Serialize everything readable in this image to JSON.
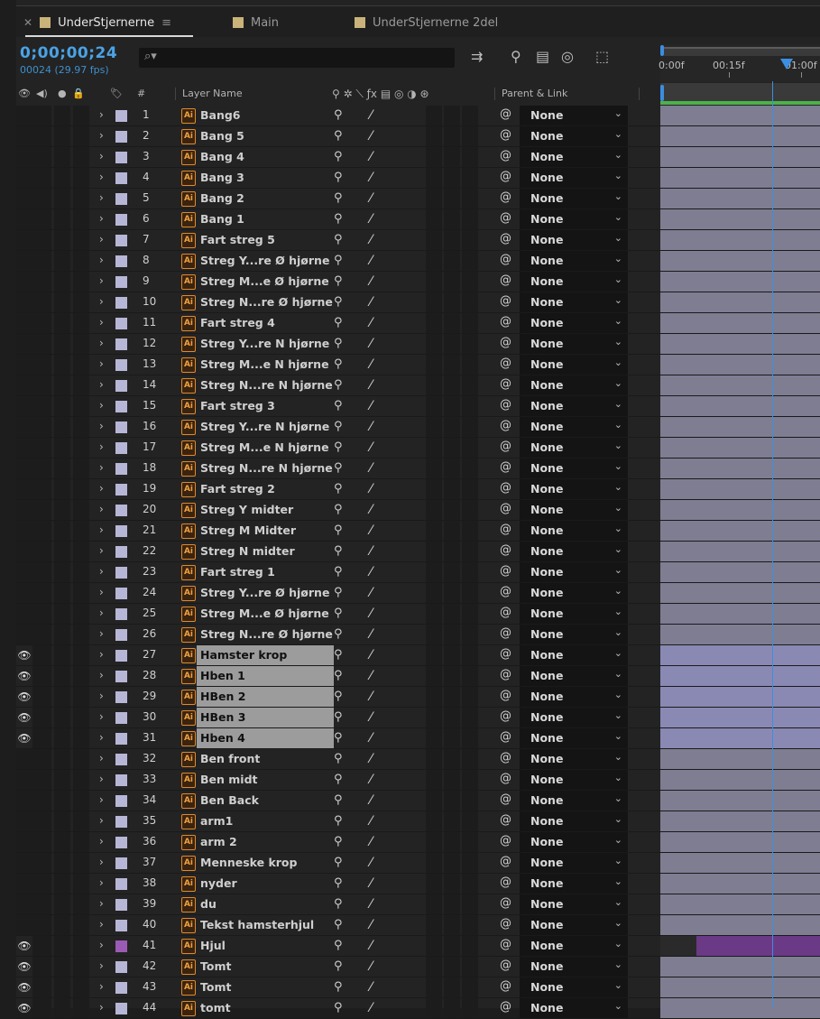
{
  "tabs": [
    {
      "label": "UnderStjernerne",
      "active": true
    },
    {
      "label": "Main",
      "active": false
    },
    {
      "label": "UnderStjernerne 2del",
      "active": false
    }
  ],
  "header": {
    "timecode": "0;00;00;24",
    "fps": "00024 (29.97 fps)",
    "search_placeholder": ""
  },
  "ruler": {
    "labels": [
      "0:00f",
      "00:15f",
      "01:00f"
    ]
  },
  "columns": {
    "num": "#",
    "layer_name": "Layer Name",
    "parent_link": "Parent & Link"
  },
  "parent_default": "None",
  "layers": [
    {
      "num": "1",
      "name": "Bang6",
      "visible": false,
      "selected": false
    },
    {
      "num": "2",
      "name": "Bang 5",
      "visible": false,
      "selected": false
    },
    {
      "num": "3",
      "name": "Bang 4",
      "visible": false,
      "selected": false
    },
    {
      "num": "4",
      "name": "Bang 3",
      "visible": false,
      "selected": false
    },
    {
      "num": "5",
      "name": "Bang 2",
      "visible": false,
      "selected": false
    },
    {
      "num": "6",
      "name": "Bang 1",
      "visible": false,
      "selected": false
    },
    {
      "num": "7",
      "name": "Fart streg 5",
      "visible": false,
      "selected": false
    },
    {
      "num": "8",
      "name": "Streg Y...re Ø hjørne",
      "visible": false,
      "selected": false
    },
    {
      "num": "9",
      "name": "Streg M...e Ø hjørne",
      "visible": false,
      "selected": false
    },
    {
      "num": "10",
      "name": "Streg N...re Ø hjørne",
      "visible": false,
      "selected": false
    },
    {
      "num": "11",
      "name": "Fart streg 4",
      "visible": false,
      "selected": false
    },
    {
      "num": "12",
      "name": "Streg Y...re N hjørne",
      "visible": false,
      "selected": false
    },
    {
      "num": "13",
      "name": "Streg M...e N hjørne",
      "visible": false,
      "selected": false
    },
    {
      "num": "14",
      "name": "Streg N...re N hjørne",
      "visible": false,
      "selected": false
    },
    {
      "num": "15",
      "name": "Fart streg 3",
      "visible": false,
      "selected": false
    },
    {
      "num": "16",
      "name": "Streg Y...re N hjørne",
      "visible": false,
      "selected": false
    },
    {
      "num": "17",
      "name": "Streg M...e N hjørne",
      "visible": false,
      "selected": false
    },
    {
      "num": "18",
      "name": "Streg N...re N hjørne",
      "visible": false,
      "selected": false
    },
    {
      "num": "19",
      "name": "Fart streg 2",
      "visible": false,
      "selected": false
    },
    {
      "num": "20",
      "name": "Streg Y midter",
      "visible": false,
      "selected": false
    },
    {
      "num": "21",
      "name": "Streg M Midter",
      "visible": false,
      "selected": false
    },
    {
      "num": "22",
      "name": "Streg N midter",
      "visible": false,
      "selected": false
    },
    {
      "num": "23",
      "name": "Fart streg 1",
      "visible": false,
      "selected": false
    },
    {
      "num": "24",
      "name": "Streg Y...re Ø hjørne",
      "visible": false,
      "selected": false
    },
    {
      "num": "25",
      "name": "Streg M...e Ø hjørne",
      "visible": false,
      "selected": false
    },
    {
      "num": "26",
      "name": "Streg N...re Ø hjørne",
      "visible": false,
      "selected": false
    },
    {
      "num": "27",
      "name": "Hamster krop",
      "visible": true,
      "selected": true
    },
    {
      "num": "28",
      "name": "Hben 1",
      "visible": true,
      "selected": true
    },
    {
      "num": "29",
      "name": "HBen 2",
      "visible": true,
      "selected": true
    },
    {
      "num": "30",
      "name": "HBen 3",
      "visible": true,
      "selected": true
    },
    {
      "num": "31",
      "name": "Hben 4",
      "visible": true,
      "selected": true
    },
    {
      "num": "32",
      "name": "Ben front",
      "visible": false,
      "selected": false
    },
    {
      "num": "33",
      "name": "Ben midt",
      "visible": false,
      "selected": false
    },
    {
      "num": "34",
      "name": "Ben Back",
      "visible": false,
      "selected": false
    },
    {
      "num": "35",
      "name": "arm1",
      "visible": false,
      "selected": false
    },
    {
      "num": "36",
      "name": "arm 2",
      "visible": false,
      "selected": false
    },
    {
      "num": "37",
      "name": "Menneske krop",
      "visible": false,
      "selected": false
    },
    {
      "num": "38",
      "name": "nyder",
      "visible": false,
      "selected": false
    },
    {
      "num": "39",
      "name": "du",
      "visible": false,
      "selected": false
    },
    {
      "num": "40",
      "name": "Tekst hamsterhjul",
      "visible": false,
      "selected": false
    },
    {
      "num": "41",
      "name": "Hjul",
      "visible": true,
      "selected": false,
      "label_color": "#9b5bb5",
      "track": "purple"
    },
    {
      "num": "42",
      "name": "Tomt",
      "visible": true,
      "selected": false
    },
    {
      "num": "43",
      "name": "Tomt",
      "visible": true,
      "selected": false
    },
    {
      "num": "44",
      "name": "tomt",
      "visible": true,
      "selected": false
    }
  ],
  "colors": {
    "accent_blue": "#3c8ee0",
    "timecode": "#4aa3e6",
    "label_default": "#b8b6d6",
    "track_default": "#7e7d92",
    "work_area": "#4bb34b"
  }
}
